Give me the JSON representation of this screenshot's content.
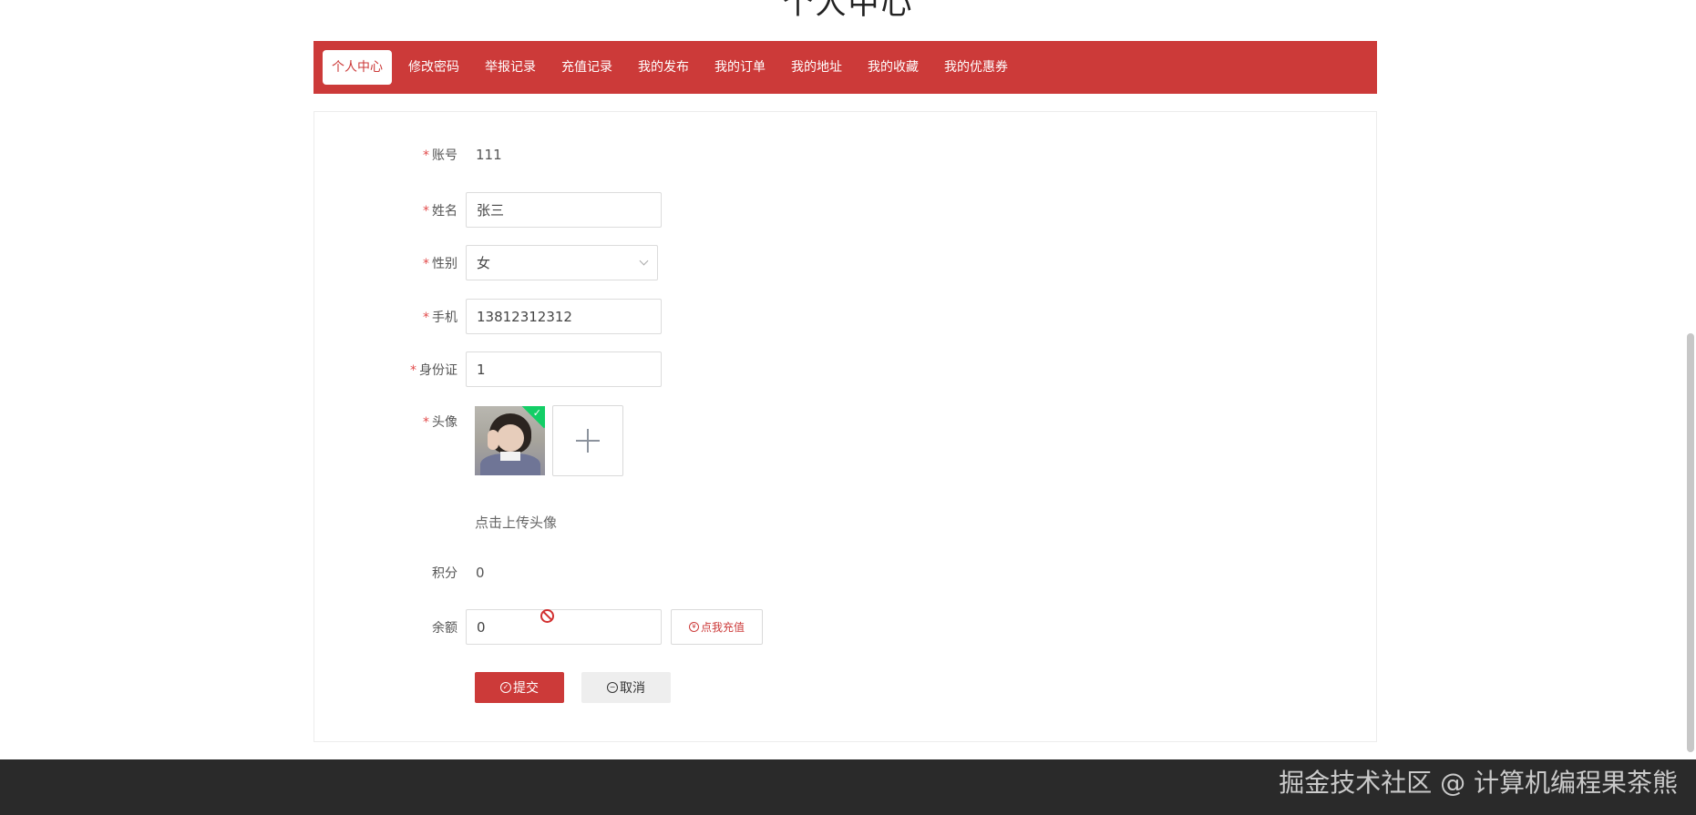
{
  "page": {
    "title": "个人中心"
  },
  "nav": {
    "items": [
      {
        "label": "个人中心",
        "active": true
      },
      {
        "label": "修改密码"
      },
      {
        "label": "举报记录"
      },
      {
        "label": "充值记录"
      },
      {
        "label": "我的发布"
      },
      {
        "label": "我的订单"
      },
      {
        "label": "我的地址"
      },
      {
        "label": "我的收藏"
      },
      {
        "label": "我的优惠券"
      }
    ]
  },
  "form": {
    "required_mark": "*",
    "account": {
      "label": "账号",
      "value": "111"
    },
    "name": {
      "label": "姓名",
      "value": "张三"
    },
    "gender": {
      "label": "性别",
      "value": "女"
    },
    "phone": {
      "label": "手机",
      "value": "13812312312"
    },
    "id_card": {
      "label": "身份证",
      "value": "1"
    },
    "avatar": {
      "label": "头像",
      "hint": "点击上传头像"
    },
    "points": {
      "label": "积分",
      "value": "0"
    },
    "balance": {
      "label": "余额",
      "value": "0",
      "recharge_label": "点我充值"
    },
    "submit_label": "提交",
    "cancel_label": "取消"
  },
  "footer": {
    "watermark": "掘金技术社区 @ 计算机编程果茶熊"
  },
  "colors": {
    "accent": "#cc3a39",
    "footer": "#2a2a2a"
  }
}
